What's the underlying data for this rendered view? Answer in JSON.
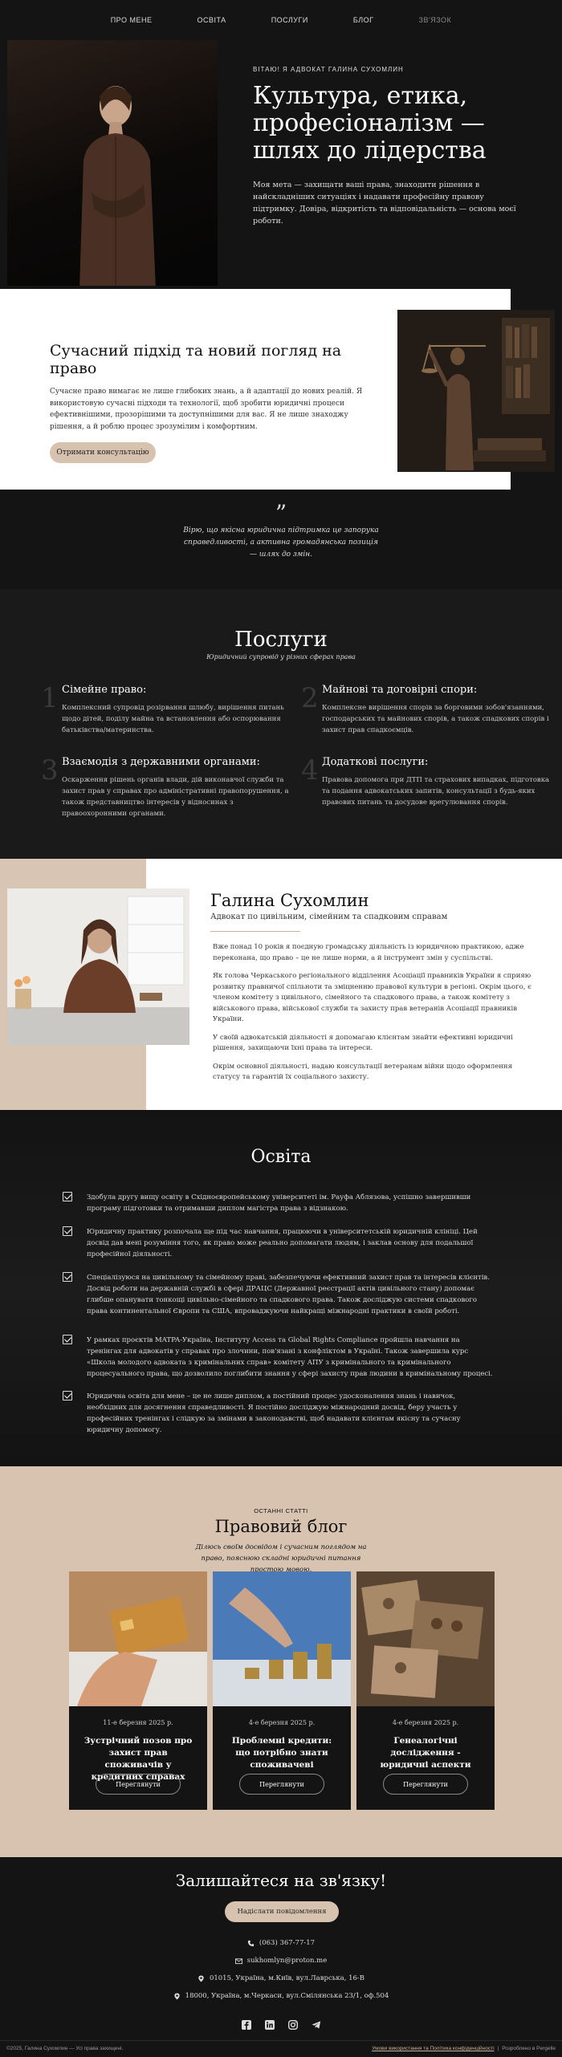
{
  "nav": {
    "items": [
      "ПРО МЕНЕ",
      "ОСВІТА",
      "ПОСЛУГИ",
      "БЛОГ",
      "ЗВ'ЯЗОК"
    ]
  },
  "hero": {
    "eyebrow": "ВІТАЮ! Я АДВОКАТ ГАЛИНА СУХОМЛИН",
    "title": "Культура, етика, професіоналізм — шлях до лідерства",
    "text": "Моя мета — захищати ваші права, знаходити рішення в найскладніших ситуаціях і надавати професійну правову підтримку. Довіра, відкритість та відповідальність — основа моєї роботи."
  },
  "approach": {
    "title": "Сучасний підхід та новий погляд на право",
    "text": "Сучасне право вимагає не лише глибоких знань, а й адаптації до нових реалій. Я використовую сучасні підходи та технології, щоб зробити юридичні процеси ефективнішими, прозорішими та доступнішими для вас. Я не лише знаходжу рішення, а й роблю процес зрозумілим і комфортним.",
    "button": "Отримати консультацію"
  },
  "quote": {
    "mark": "”",
    "text": "Вірю, що якісна юридична підтримка це запорука справедливості, а активна громадянська позиція — шлях до змін."
  },
  "services": {
    "title": "Послуги",
    "subtitle": "Юридичний супровід у різних сферах права",
    "items": [
      {
        "num": "1",
        "title": "Сімейне право:",
        "text": "Комплексний супровід розірвання шлюбу, вирішення питань щодо дітей, поділу майна та встановлення або оспорювання батьківства/материнства."
      },
      {
        "num": "2",
        "title": "Майнові та договірні спори:",
        "text": "Комплексне вирішення спорів за борговими зобов'язаннями, господарських та майнових спорів, а також спадкових спорів і захист прав спадкоємців."
      },
      {
        "num": "3",
        "title": "Взаємодія з державними органами:",
        "text": "Оскарження рішень органів влади, дій виконавчої служби та захист прав у справах про адміністративні правопорушення, а також представництво інтересів у відносинах з правоохоронними органами."
      },
      {
        "num": "4",
        "title": "Додаткові послуги:",
        "text": "Правова допомога при ДТП та страхових випадках, підготовка та подання адвокатських запитів, консультації з будь-яких правових питань та досудове врегулювання спорів."
      }
    ]
  },
  "about": {
    "name": "Галина Сухомлин",
    "role": "Адвокат по цивільним, сімейним та спадковим справам",
    "paragraphs": [
      "Вже понад 10 років я поєдную громадську діяльність із юридичною практикою, адже переконана, що право – це не лише норми, а й інструмент змін у суспільстві.",
      "Як голова Черкаського регіонального відділення Асоціації правників України я сприяю розвитку правничої спільноти та зміцненню правової культури в регіоні. Окрім цього, є членом комітету з цивільного, сімейного та спадкового права, а також комітету з військового права, військової служби та захисту прав ветеранів Асоціації правників України.",
      "У своїй адвокатській діяльності я допомагаю клієнтам знайти ефективні юридичні рішення, захищаючи їхні права та інтереси.",
      "Окрім основної діяльності, надаю консультації ветеранам війни щодо оформлення статусу та гарантій їх соціального захисту."
    ]
  },
  "education": {
    "title": "Освіта",
    "items": [
      "Здобула другу вищу освіту в Східноєвропейському університеті ім. Рауфа Аблязова, успішно завершивши програму підготовки та отримавши диплом магістра права з відзнакою.",
      "Юридичну практику розпочала ще під час навчання, працюючи в університетській юридичній клініці. Цей досвід дав мені розуміння того, як право може реально допомагати людям, і заклав основу для подальшої професійної діяльності.",
      "Спеціалізуюся на цивільному та сімейному праві, забезпечуючи ефективний захист прав та інтересів клієнтів. Досвід роботи на державній службі в сфері ДРАЦС (Державної реєстрації актів цивільного стану) допомає глибше опанувати тонкощі цивільно-сімейного та спадкового права. Також досліджую системи спадкового права континентальної Європи та США, впроваджуючи найкращі міжнародні практики в своїй роботі.",
      "У рамках проєктів MATPA-Україна, Інституту Access та Global Rights Compliance пройшла навчання на тренінгах для адвокатів у справах про злочини, пов'язані з конфліктом в Україні. Також завершила курс «Школа молодого адвоката з кримінальних справ» комітету АПУ з кримінального та кримінального процесуального права, що дозволило поглибити знання у сфері захисту прав людини в кримінальному процесі.",
      "Юридична освіта для мене – це не лише диплом, а постійний процес удосконалення знань і навичок, необхідних для досягнення справедливості. Я постійно досліджую міжнародний досвід, беру участь у професійних тренінгах і слідкую за змінами в законодавстві, щоб надавати клієнтам якісну та сучасну юридичну допомогу."
    ]
  },
  "blog": {
    "eyebrow": "ОСТАННІ СТАТТІ",
    "title": "Правовий блог",
    "lead": "Ділюсь своїм досвідом і сучасним поглядом на право, пояснюю складні юридичні питання простою мовою.",
    "cards": [
      {
        "date": "11-е березня 2025 р.",
        "title": "Зустрічний позов про захист прав споживачів у кредитних справах",
        "button": "Переглянути"
      },
      {
        "date": "4-е березня 2025 р.",
        "title": "Проблемні кредити: що потрібно знати споживачеві",
        "button": "Переглянути"
      },
      {
        "date": "4-е березня 2025 р.",
        "title": "Генеалогічні дослідження - юридичні аспекти",
        "button": "Переглянути"
      }
    ]
  },
  "contact": {
    "title": "Залишайтеся на зв'язку!",
    "button": "Надіслати повідомлення",
    "phone": "(063) 367-77-17",
    "email": "sukhomlyn@proton.me",
    "address1": "01015, Україна, м.Київ, вул.Лаврська, 16-В",
    "address2": "18000, Україна, м.Черкаси, вул.Смілянська 23/1, оф.504"
  },
  "footer": {
    "copyright": "©2025, Галина Сухомлин — Усі права захищені.",
    "terms": "Умови використання та Політика конфіденційності",
    "sep": "|",
    "dev": "Розроблено в Pergelle"
  },
  "colors": {
    "dark": "#141414",
    "beige": "#d7c3b0",
    "white": "#ffffff"
  }
}
